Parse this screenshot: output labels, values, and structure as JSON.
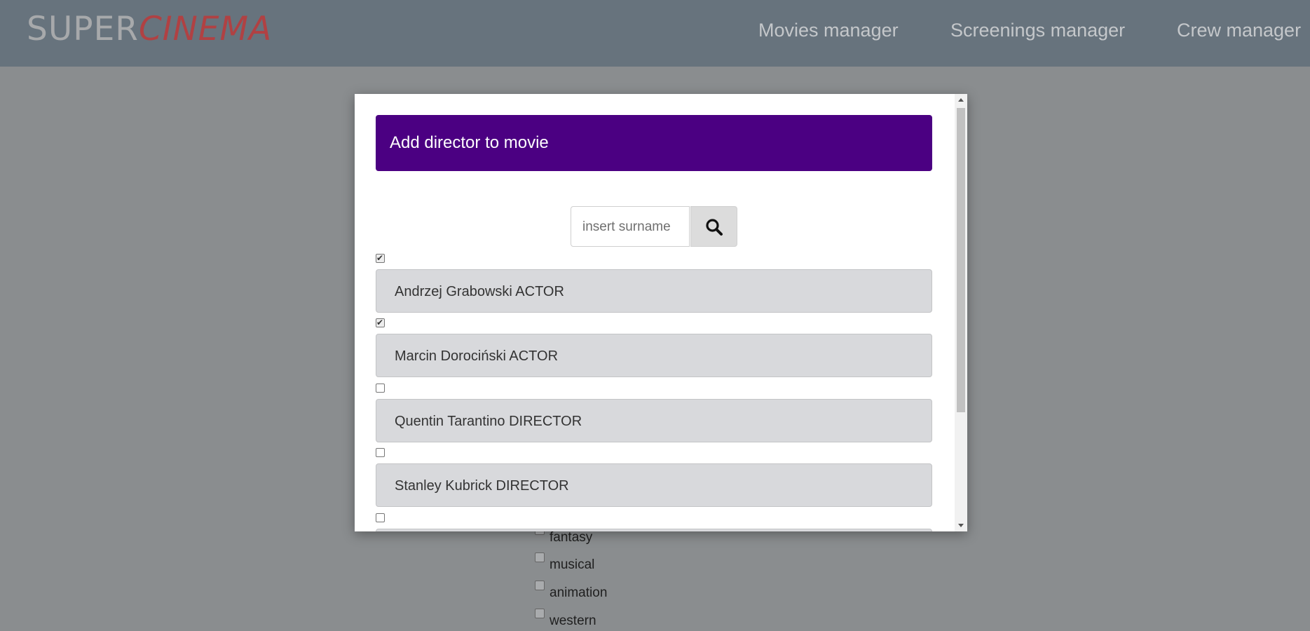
{
  "brand": {
    "part1": "SUPER",
    "part2": "CINEMA"
  },
  "nav": {
    "movies": "Movies manager",
    "screenings": "Screenings manager",
    "crew": "Crew manager"
  },
  "genres": [
    "fantasy",
    "musical",
    "animation",
    "western"
  ],
  "modal": {
    "title": "Add director to movie",
    "search": {
      "placeholder": "insert surname",
      "value": ""
    },
    "crew": [
      {
        "label": "Andrzej Grabowski ACTOR",
        "checked": true
      },
      {
        "label": "Marcin Dorociński ACTOR",
        "checked": true
      },
      {
        "label": "Quentin Tarantino DIRECTOR",
        "checked": false
      },
      {
        "label": "Stanley Kubrick DIRECTOR",
        "checked": false
      },
      {
        "label": "",
        "checked": false
      }
    ]
  },
  "colors": {
    "header": "#4b0082",
    "navbar": "#67737d",
    "brand_accent": "#b04143",
    "row_bg": "#d8d9dc"
  },
  "icons": {
    "search": "search-icon"
  }
}
